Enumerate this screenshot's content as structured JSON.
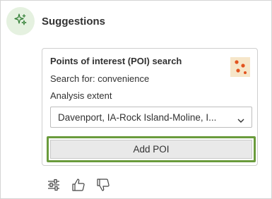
{
  "header": {
    "title": "Suggestions",
    "icon": "sparkle-icon"
  },
  "card": {
    "title": "Points of interest (POI) search",
    "search_for": "Search for: convenience",
    "extent_label": "Analysis extent",
    "extent_value": "Davenport, IA-Rock Island-Moline, I...",
    "add_button": "Add POI",
    "thumbnail_icon": "poi-map-thumbnail"
  },
  "actions": [
    "settings-sliders-icon",
    "thumbs-up-icon",
    "thumbs-down-icon"
  ],
  "colors": {
    "avatar_bg": "#e5f1e0",
    "highlight_border": "#6a9b3c",
    "poi_dot": "#e2531f",
    "thumb_bg": "#f6e6c9"
  }
}
